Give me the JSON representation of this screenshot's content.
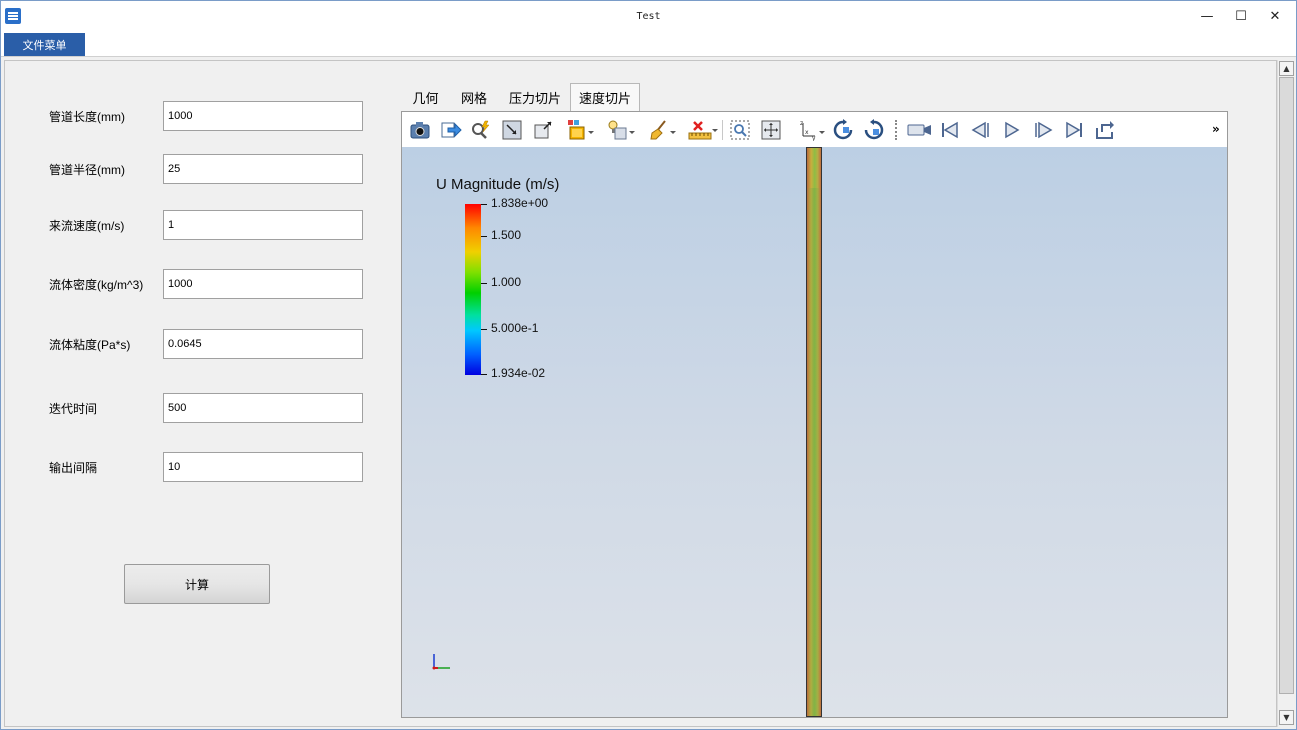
{
  "window": {
    "title": "Test",
    "minimize": "—",
    "maximize": "☐",
    "close": "✕"
  },
  "menu": {
    "file": "文件菜单"
  },
  "form": {
    "fields": [
      {
        "label": "管道长度(mm)",
        "value": "1000"
      },
      {
        "label": "管道半径(mm)",
        "value": "25"
      },
      {
        "label": "来流速度(m/s)",
        "value": "1"
      },
      {
        "label": "流体密度(kg/m^3)",
        "value": "1000"
      },
      {
        "label": "流体粘度(Pa*s)",
        "value": "0.0645"
      },
      {
        "label": "迭代时间",
        "value": "500"
      },
      {
        "label": "输出间隔",
        "value": "10"
      }
    ],
    "calc_button": "计算"
  },
  "tabs": [
    {
      "label": "几何"
    },
    {
      "label": "网格"
    },
    {
      "label": "压力切片"
    },
    {
      "label": "速度切片",
      "active": true
    }
  ],
  "toolbar": {
    "overflow": "»",
    "icons": [
      "camera-icon",
      "export-icon",
      "zoom-spark-icon",
      "reset-camera-icon",
      "zoom-to-data-icon",
      "color-settings-icon",
      "lighting-icon",
      "clear-icon",
      "ruler-icon",
      "zoom-box-icon",
      "pick-center-icon",
      "axes-orientation-icon",
      "rotate-cw-icon",
      "rotate-ccw-icon",
      "video-camera-icon",
      "first-frame-icon",
      "prev-frame-icon",
      "play-icon",
      "next-frame-icon",
      "last-frame-icon",
      "loop-icon"
    ]
  },
  "viewport": {
    "legend": {
      "title": "U Magnitude (m/s)",
      "ticks": [
        "1.838e+00",
        "1.500",
        "1.000",
        "5.000e-1",
        "1.934e-02"
      ]
    },
    "background_top": "#bccfe4",
    "background_bottom": "#dde2e9"
  }
}
